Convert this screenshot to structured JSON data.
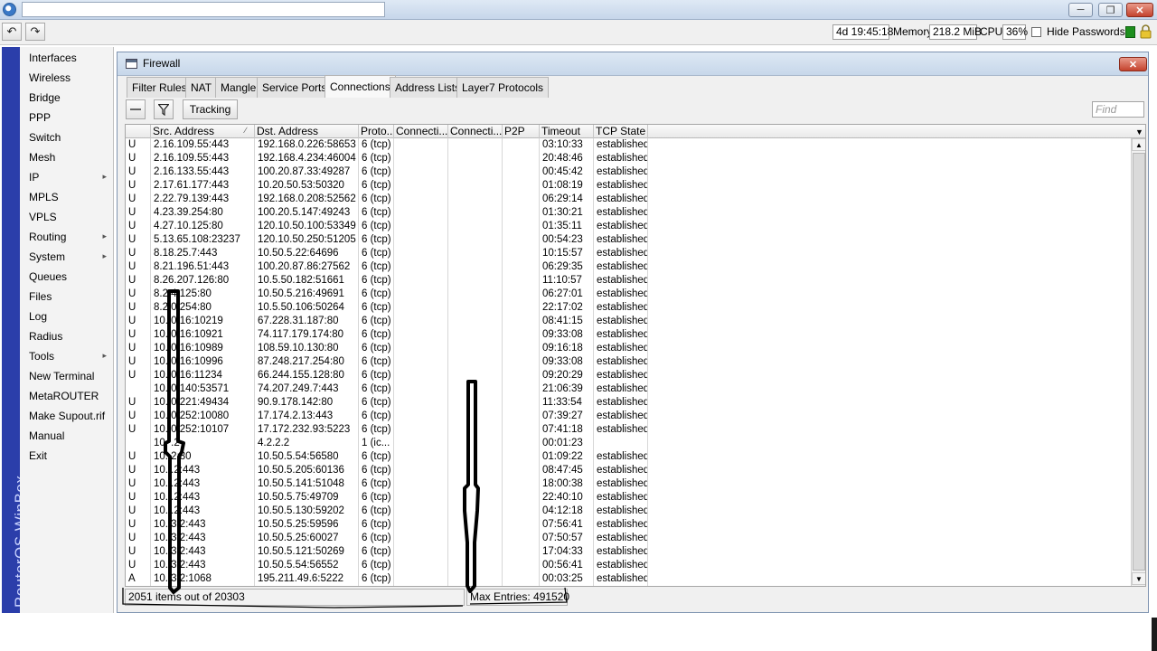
{
  "toolbar": {
    "uptime": "4d 19:45:18",
    "memory_label": "Memory:",
    "memory_value": "218.2 MiB",
    "cpu_label": "CPU:",
    "cpu_value": "36%",
    "hide_passwords_label": "Hide Passwords",
    "hide_passwords_checked": false
  },
  "brand": "RouterOS WinBox",
  "menu": [
    {
      "label": "Interfaces",
      "submenu": false
    },
    {
      "label": "Wireless",
      "submenu": false
    },
    {
      "label": "Bridge",
      "submenu": false
    },
    {
      "label": "PPP",
      "submenu": false
    },
    {
      "label": "Switch",
      "submenu": false
    },
    {
      "label": "Mesh",
      "submenu": false
    },
    {
      "label": "IP",
      "submenu": true
    },
    {
      "label": "MPLS",
      "submenu": false
    },
    {
      "label": "VPLS",
      "submenu": false
    },
    {
      "label": "Routing",
      "submenu": true
    },
    {
      "label": "System",
      "submenu": true
    },
    {
      "label": "Queues",
      "submenu": false
    },
    {
      "label": "Files",
      "submenu": false
    },
    {
      "label": "Log",
      "submenu": false
    },
    {
      "label": "Radius",
      "submenu": false
    },
    {
      "label": "Tools",
      "submenu": true
    },
    {
      "label": "New Terminal",
      "submenu": false
    },
    {
      "label": "MetaROUTER",
      "submenu": false
    },
    {
      "label": "Make Supout.rif",
      "submenu": false
    },
    {
      "label": "Manual",
      "submenu": false
    },
    {
      "label": "Exit",
      "submenu": false
    }
  ],
  "firewall": {
    "title": "Firewall",
    "tabs": [
      "Filter Rules",
      "NAT",
      "Mangle",
      "Service Ports",
      "Connections",
      "Address Lists",
      "Layer7 Protocols"
    ],
    "active_tab": "Connections",
    "tracking_label": "Tracking",
    "find_placeholder": "Find",
    "columns": [
      "",
      "Src. Address",
      "Dst. Address",
      "Proto...",
      "Connecti...",
      "Connecti...",
      "P2P",
      "Timeout",
      "TCP State"
    ],
    "rows": [
      [
        "U",
        "2.16.109.55:443",
        "192.168.0.226:58653",
        "6 (tcp)",
        "",
        "",
        "",
        "03:10:33",
        "established"
      ],
      [
        "U",
        "2.16.109.55:443",
        "192.168.4.234:46004",
        "6 (tcp)",
        "",
        "",
        "",
        "20:48:46",
        "established"
      ],
      [
        "U",
        "2.16.133.55:443",
        "100.20.87.33:49287",
        "6 (tcp)",
        "",
        "",
        "",
        "00:45:42",
        "established"
      ],
      [
        "U",
        "2.17.61.177:443",
        "10.20.50.53:50320",
        "6 (tcp)",
        "",
        "",
        "",
        "01:08:19",
        "established"
      ],
      [
        "U",
        "2.22.79.139:443",
        "192.168.0.208:52562",
        "6 (tcp)",
        "",
        "",
        "",
        "06:29:14",
        "established"
      ],
      [
        "U",
        "4.23.39.254:80",
        "100.20.5.147:49243",
        "6 (tcp)",
        "",
        "",
        "",
        "01:30:21",
        "established"
      ],
      [
        "U",
        "4.27.10.125:80",
        "120.10.50.100:53349",
        "6 (tcp)",
        "",
        "",
        "",
        "01:35:11",
        "established"
      ],
      [
        "U",
        "5.13.65.108:23237",
        "120.10.50.250:51205",
        "6 (tcp)",
        "",
        "",
        "",
        "00:54:23",
        "established"
      ],
      [
        "U",
        "8.18.25.7:443",
        "10.50.5.22:64696",
        "6 (tcp)",
        "",
        "",
        "",
        "10:15:57",
        "established"
      ],
      [
        "U",
        "8.21.196.51:443",
        "100.20.87.86:27562",
        "6 (tcp)",
        "",
        "",
        "",
        "06:29:35",
        "established"
      ],
      [
        "U",
        "8.26.207.126:80",
        "10.5.50.182:51661",
        "6 (tcp)",
        "",
        "",
        "",
        "11:10:57",
        "established"
      ],
      [
        "U",
        "8.2   4.125:80",
        "10.50.5.216:49691",
        "6 (tcp)",
        "",
        "",
        "",
        "06:27:01",
        "established"
      ],
      [
        "U",
        "8.2   0.254:80",
        "10.5.50.106:50264",
        "6 (tcp)",
        "",
        "",
        "",
        "22:17:02",
        "established"
      ],
      [
        "U",
        "10.   0.16:10219",
        "67.228.31.187:80",
        "6 (tcp)",
        "",
        "",
        "",
        "08:41:15",
        "established"
      ],
      [
        "U",
        "10.   0.16:10921",
        "74.117.179.174:80",
        "6 (tcp)",
        "",
        "",
        "",
        "09:33:08",
        "established"
      ],
      [
        "U",
        "10.   0.16:10989",
        "108.59.10.130:80",
        "6 (tcp)",
        "",
        "",
        "",
        "09:16:18",
        "established"
      ],
      [
        "U",
        "10.   0.16:10996",
        "87.248.217.254:80",
        "6 (tcp)",
        "",
        "",
        "",
        "09:33:08",
        "established"
      ],
      [
        "U",
        "10.   0.16:11234",
        "66.244.155.128:80",
        "6 (tcp)",
        "",
        "",
        "",
        "09:20:29",
        "established"
      ],
      [
        "",
        "10.   0.140:53571",
        "74.207.249.7:443",
        "6 (tcp)",
        "",
        "",
        "",
        "21:06:39",
        "established"
      ],
      [
        "U",
        "10.   0.221:49434",
        "90.9.178.142:80",
        "6 (tcp)",
        "",
        "",
        "",
        "11:33:54",
        "established"
      ],
      [
        "U",
        "10.   0.252:10080",
        "17.174.2.13:443",
        "6 (tcp)",
        "",
        "",
        "",
        "07:39:27",
        "established"
      ],
      [
        "U",
        "10.   0.252:10107",
        "17.172.232.93:5223",
        "6 (tcp)",
        "",
        "",
        "",
        "07:41:18",
        "established"
      ],
      [
        "",
        "10.   .2",
        "4.2.2.2",
        "1 (ic...",
        "",
        "",
        "",
        "00:01:23",
        ""
      ],
      [
        "U",
        "10.   2:80",
        "10.50.5.54:56580",
        "6 (tcp)",
        "",
        "",
        "",
        "01:09:22",
        "established"
      ],
      [
        "U",
        "10.   .2:443",
        "10.50.5.205:60136",
        "6 (tcp)",
        "",
        "",
        "",
        "08:47:45",
        "established"
      ],
      [
        "U",
        "10.   .2:443",
        "10.50.5.141:51048",
        "6 (tcp)",
        "",
        "",
        "",
        "18:00:38",
        "established"
      ],
      [
        "U",
        "10.   .2:443",
        "10.50.5.75:49709",
        "6 (tcp)",
        "",
        "",
        "",
        "22:40:10",
        "established"
      ],
      [
        "U",
        "10.   .2:443",
        "10.50.5.130:59202",
        "6 (tcp)",
        "",
        "",
        "",
        "04:12:18",
        "established"
      ],
      [
        "U",
        "10.   3.2:443",
        "10.50.5.25:59596",
        "6 (tcp)",
        "",
        "",
        "",
        "07:56:41",
        "established"
      ],
      [
        "U",
        "10.   3.2:443",
        "10.50.5.25:60027",
        "6 (tcp)",
        "",
        "",
        "",
        "07:50:57",
        "established"
      ],
      [
        "U",
        "10.   3.2:443",
        "10.50.5.121:50269",
        "6 (tcp)",
        "",
        "",
        "",
        "17:04:33",
        "established"
      ],
      [
        "U",
        "10.   3.2:443",
        "10.50.5.54:56552",
        "6 (tcp)",
        "",
        "",
        "",
        "00:56:41",
        "established"
      ],
      [
        "A",
        "10.   3.2:1068",
        "195.211.49.6:5222",
        "6 (tcp)",
        "",
        "",
        "",
        "00:03:25",
        "established"
      ]
    ],
    "items_count": "2051 items out of 20303",
    "max_entries": "Max Entries: 491520"
  }
}
